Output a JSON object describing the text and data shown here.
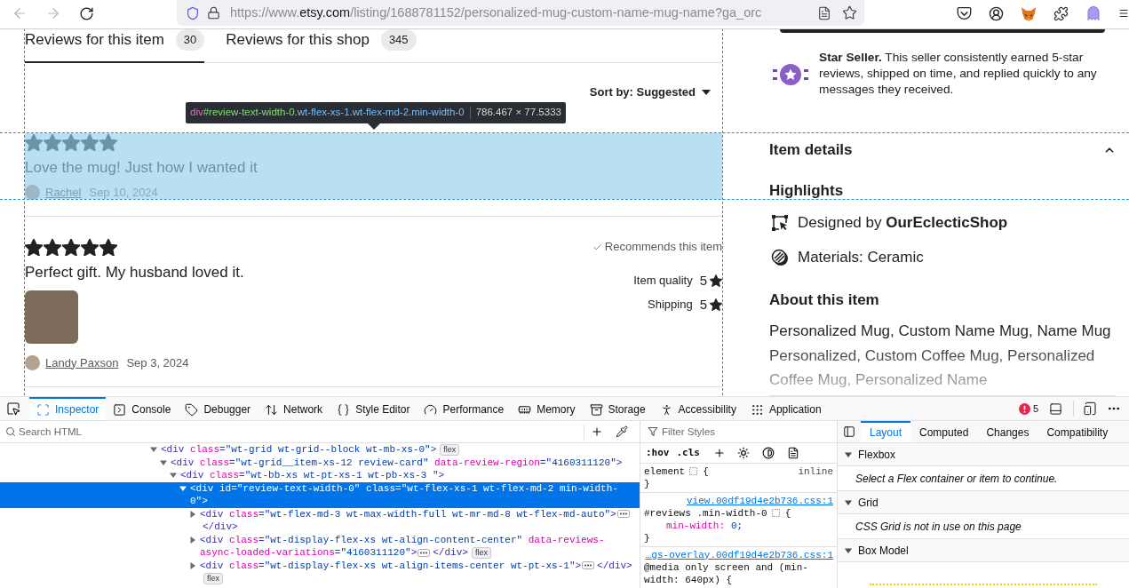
{
  "browser": {
    "back_disabled": true,
    "forward_disabled": true,
    "url": {
      "scheme": "https://www.",
      "host": "etsy.com",
      "path": "/listing/1688781152/personalized-mug-custom-name-mug-name?ga_orc"
    }
  },
  "reviews": {
    "tabs": [
      {
        "label": "Reviews for this item",
        "count": "30",
        "selected": true
      },
      {
        "label": "Reviews for this shop",
        "count": "345",
        "selected": false
      }
    ],
    "sort": "Sort by: Suggested",
    "items": [
      {
        "stars": 5,
        "text": "Love the mug! Just how I wanted it",
        "author": "Rachel",
        "date": "Sep 10, 2024",
        "highlighted": true
      },
      {
        "stars": 5,
        "text": "Perfect gift. My husband loved it.",
        "recommendation": "Recommends this item",
        "ratings": [
          {
            "label": "Item quality",
            "value": "5"
          },
          {
            "label": "Shipping",
            "value": "5"
          }
        ],
        "photo": true,
        "author": "Landy Paxson",
        "date": "Sep 3, 2024",
        "highlighted": false
      }
    ]
  },
  "inspector_tooltip": {
    "tag": "div",
    "id": "#review-text-width-0",
    "classes": ".wt-flex-xs-1.wt-flex-md-2.min-width-0",
    "size": "786.467 × 77.5333"
  },
  "shop_panel": {
    "star_seller": "**Star Seller.** This seller consistently earned 5-star reviews, shipped on time, and replied quickly to any messages they received.",
    "item_details": {
      "title": "Item details",
      "expanded": true,
      "highlights_title": "Highlights",
      "highlights": [
        {
          "kind": "designer",
          "text": "Designed by **OurEclecticShop**"
        },
        {
          "kind": "materials",
          "text": "Materials: Ceramic"
        }
      ],
      "about_title": "About this item",
      "about": "Personalized Mug, Custom Name Mug, Name Mug Personalized, Custom Coffee Mug, Personalized Coffee Mug, Personalized Name"
    }
  },
  "devtools": {
    "tabs": [
      {
        "kind": "inspector",
        "label": "Inspector",
        "selected": true
      },
      {
        "kind": "console",
        "label": "Console",
        "selected": false
      },
      {
        "kind": "debugger",
        "label": "Debugger",
        "selected": false
      },
      {
        "kind": "network",
        "label": "Network",
        "selected": false
      },
      {
        "kind": "style_editor",
        "label": "Style Editor",
        "selected": false
      },
      {
        "kind": "performance",
        "label": "Performance",
        "selected": false
      },
      {
        "kind": "memory",
        "label": "Memory",
        "selected": false
      },
      {
        "kind": "storage",
        "label": "Storage",
        "selected": false
      },
      {
        "kind": "accessibility",
        "label": "Accessibility",
        "selected": false
      },
      {
        "kind": "application",
        "label": "Application",
        "selected": false
      }
    ],
    "error_count": "5",
    "search_placeholder": "Search HTML",
    "markup": [
      {
        "markup": "<div class=\"wt-grid wt-grid--block wt-mb-xs-0\">",
        "badge": "flex",
        "expanded": true,
        "selected": false,
        "children": [
          {
            "markup": "<div class=\"wt-grid__item-xs-12 review-card\" data-review-region=\"4160311120\">",
            "expanded": true,
            "selected": false,
            "children": [
              {
                "markup": "<div class=\"wt-bb-xs wt-pt-xs-1 wt-pb-xs-3 \">",
                "expanded": true,
                "selected": false,
                "children": [
                  {
                    "markup": "<div id=\"review-text-width-0\" class=\"wt-flex-xs-1 wt-flex-md-2 min-width-0\">",
                    "expanded": true,
                    "selected": true,
                    "children": [
                      {
                        "markup": "<div class=\"wt-flex-md-3 wt-max-width-full wt-mr-md-8 wt-flex-md-auto\">",
                        "closing": "</div>",
                        "expanded": false,
                        "selected": false
                      },
                      {
                        "markup": "<div class=\"wt-display-flex-xs wt-align-content-center\" data-reviews-async-loaded-variations=\"4160311120\">",
                        "closing": "</div>",
                        "badge": "flex",
                        "expanded": false,
                        "selected": false
                      },
                      {
                        "markup": "<div class=\"wt-display-flex-xs wt-align-items-center wt-pt-xs-1\">",
                        "closing": "</div>",
                        "badge": "flex",
                        "expanded": false,
                        "selected": false
                      }
                    ]
                  }
                ]
              }
            ]
          }
        ]
      }
    ],
    "styles": {
      "filter_placeholder": "Filter Styles",
      "toggles": [
        ":hov",
        ".cls"
      ],
      "rules": [
        {
          "selector": "element",
          "highlighter": true,
          "open": "{",
          "origin": "inline",
          "close": "}"
        },
        {
          "source": "view.00df19d4e2b736.css:1",
          "selector": "#reviews .min-width-0",
          "highlighter": true,
          "open": "{",
          "declarations": [
            {
              "property": "min-width:",
              "value": "0;"
            }
          ],
          "close": "}"
        },
        {
          "source": "…gs-overlay.00df19d4e2b736.css:1",
          "selector": "@media only screen and (min-width: 640px) {",
          "highlighter": false
        }
      ]
    },
    "layout": {
      "tabs": [
        {
          "label": "Layout",
          "selected": true
        },
        {
          "label": "Computed",
          "selected": false
        },
        {
          "label": "Changes",
          "selected": false
        },
        {
          "label": "Compatibility",
          "selected": false
        }
      ],
      "sections": [
        {
          "kind": "message",
          "title": "Flexbox",
          "expanded": true,
          "message": "Select a Flex container or item to continue."
        },
        {
          "kind": "message",
          "title": "Grid",
          "expanded": true,
          "message": "CSS Grid is not in use on this page"
        },
        {
          "kind": "box_model",
          "title": "Box Model",
          "expanded": true
        }
      ]
    }
  }
}
